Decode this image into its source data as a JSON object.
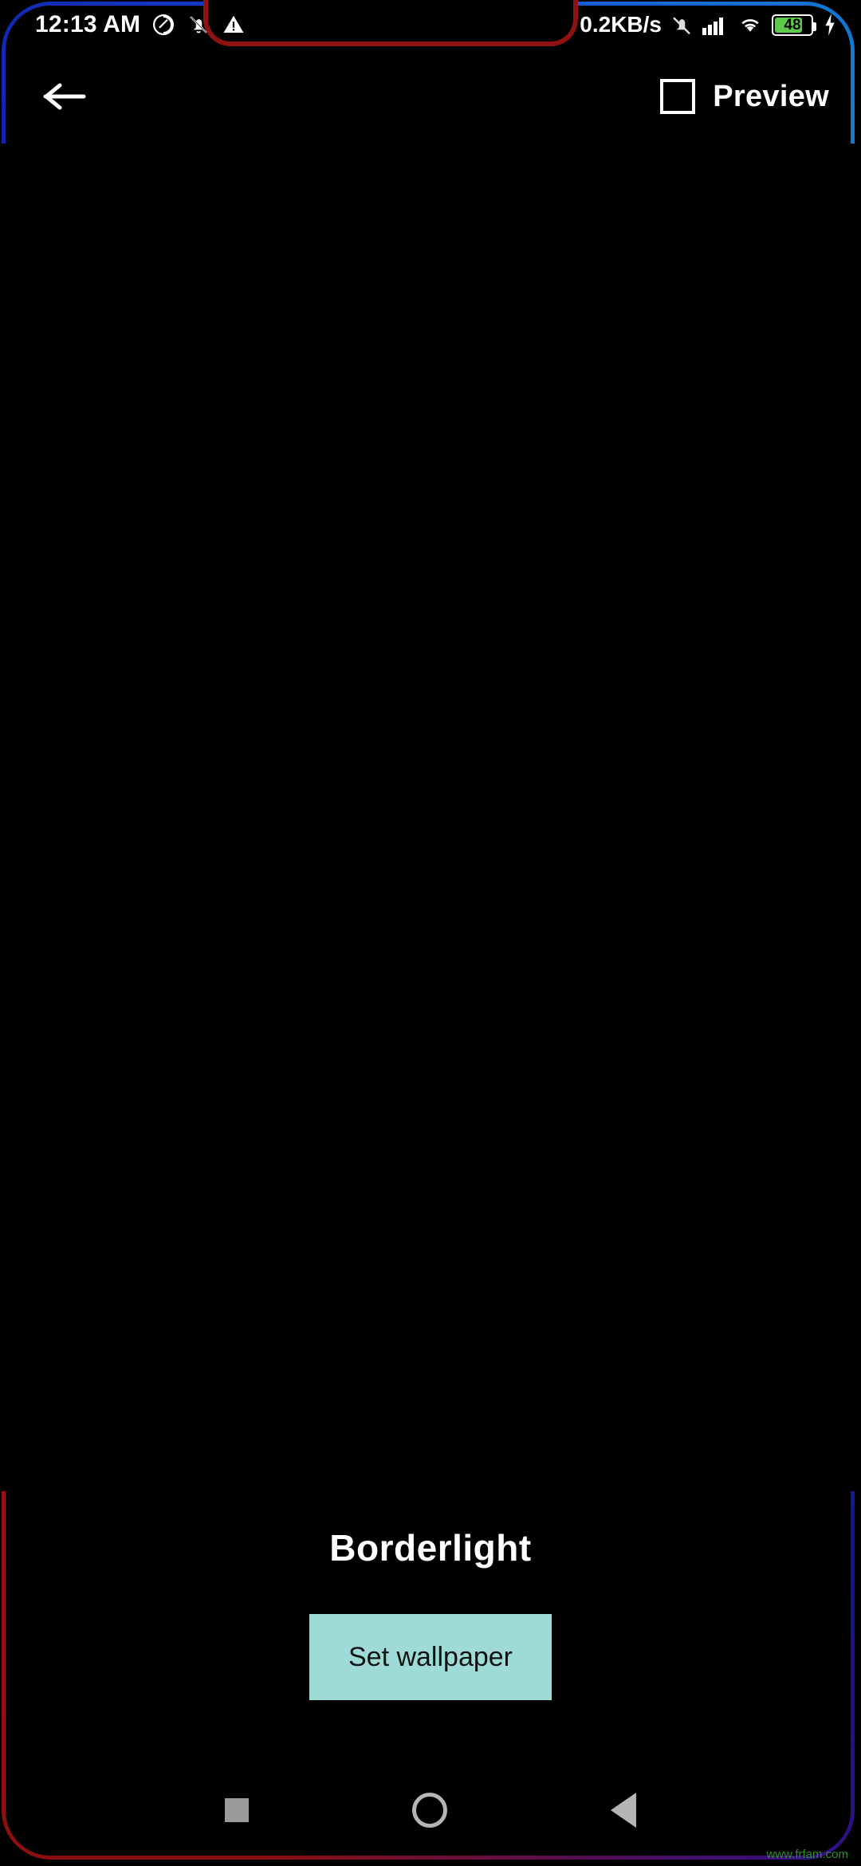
{
  "status_bar": {
    "clock": "12:13 AM",
    "network_speed": "0.2KB/s",
    "battery_percent": "48",
    "icons": [
      "do-not-disturb-icon",
      "mute-notification-icon",
      "warning-triangle-icon",
      "alarm-off-icon",
      "cellular-signal-icon",
      "wifi-icon",
      "battery-icon",
      "charging-bolt-icon"
    ]
  },
  "app_bar": {
    "back_label": "Back",
    "preview_label": "Preview"
  },
  "wallpaper": {
    "title": "Borderlight",
    "set_button_label": "Set wallpaper",
    "background_color": "#000000",
    "border_colors": [
      "#8b0f0f",
      "#12119a",
      "#1250d8",
      "#2fbf3a",
      "#6fcf2a"
    ]
  },
  "nav_bar": {
    "recents_label": "Recents",
    "home_label": "Home",
    "back_label": "Back"
  },
  "watermark": {
    "text": "www.frfam.com"
  }
}
